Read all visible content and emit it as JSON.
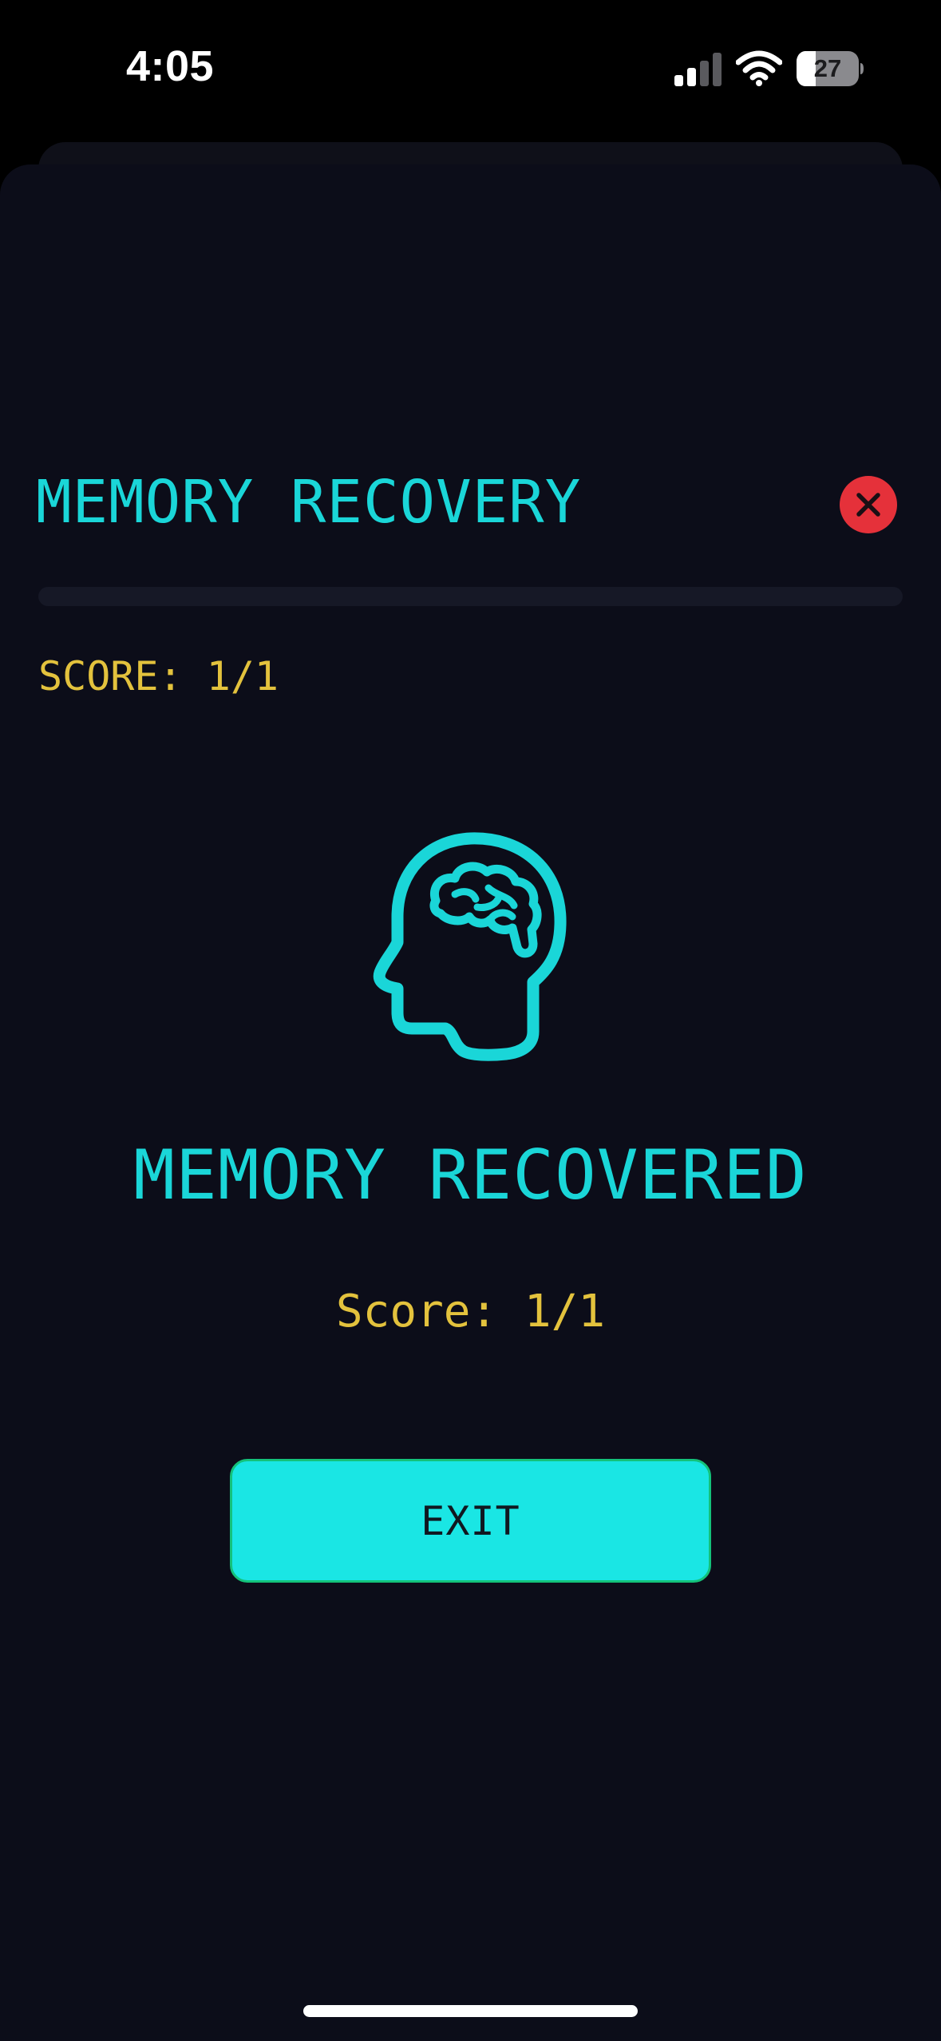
{
  "status_bar": {
    "time": "4:05",
    "battery_level": "27",
    "signal_bars_active": 2,
    "signal_bars_total": 4,
    "icons": [
      "signal-icon",
      "wifi-icon",
      "battery-icon"
    ]
  },
  "header": {
    "title": "MEMORY RECOVERY",
    "close_icon": "close-icon"
  },
  "progress": {
    "value": 0
  },
  "score_label": "SCORE: 1/1",
  "result": {
    "icon": "brain-head-icon",
    "title": "MEMORY RECOVERED",
    "score": "Score: 1/1"
  },
  "exit_button": {
    "label": "EXIT"
  },
  "colors": {
    "background": "#0c0d19",
    "accent_cyan": "#1ad6d8",
    "score_yellow": "#e3c23d",
    "close_red": "#e5313a",
    "button_fill": "#1ae6e4",
    "button_border": "#14c27a"
  }
}
